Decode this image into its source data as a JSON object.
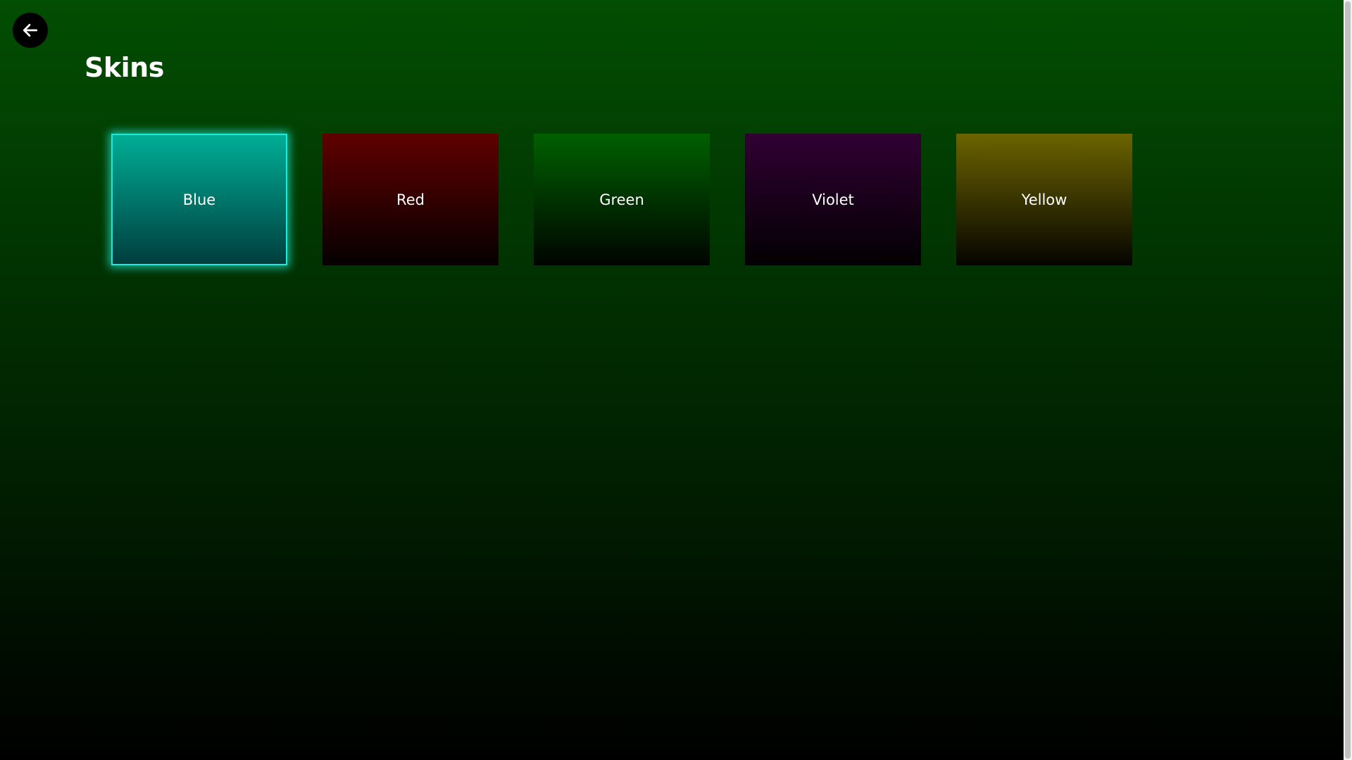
{
  "page": {
    "title": "Skins",
    "back_icon": "arrow-left-icon"
  },
  "skins": [
    {
      "label": "Blue",
      "top_color": "#00ae96",
      "bottom_color": "#003e3e",
      "selected": true
    },
    {
      "label": "Red",
      "top_color": "#600000",
      "bottom_color": "#050000",
      "selected": false
    },
    {
      "label": "Green",
      "top_color": "#006000",
      "bottom_color": "#000400",
      "selected": false
    },
    {
      "label": "Violet",
      "top_color": "#300032",
      "bottom_color": "#020002",
      "selected": false
    },
    {
      "label": "Yellow",
      "top_color": "#6c6400",
      "bottom_color": "#050400",
      "selected": false
    }
  ],
  "theme": {
    "background_top": "#024e02",
    "background_bottom": "#000000",
    "selected_outline": "#22e8d4"
  }
}
